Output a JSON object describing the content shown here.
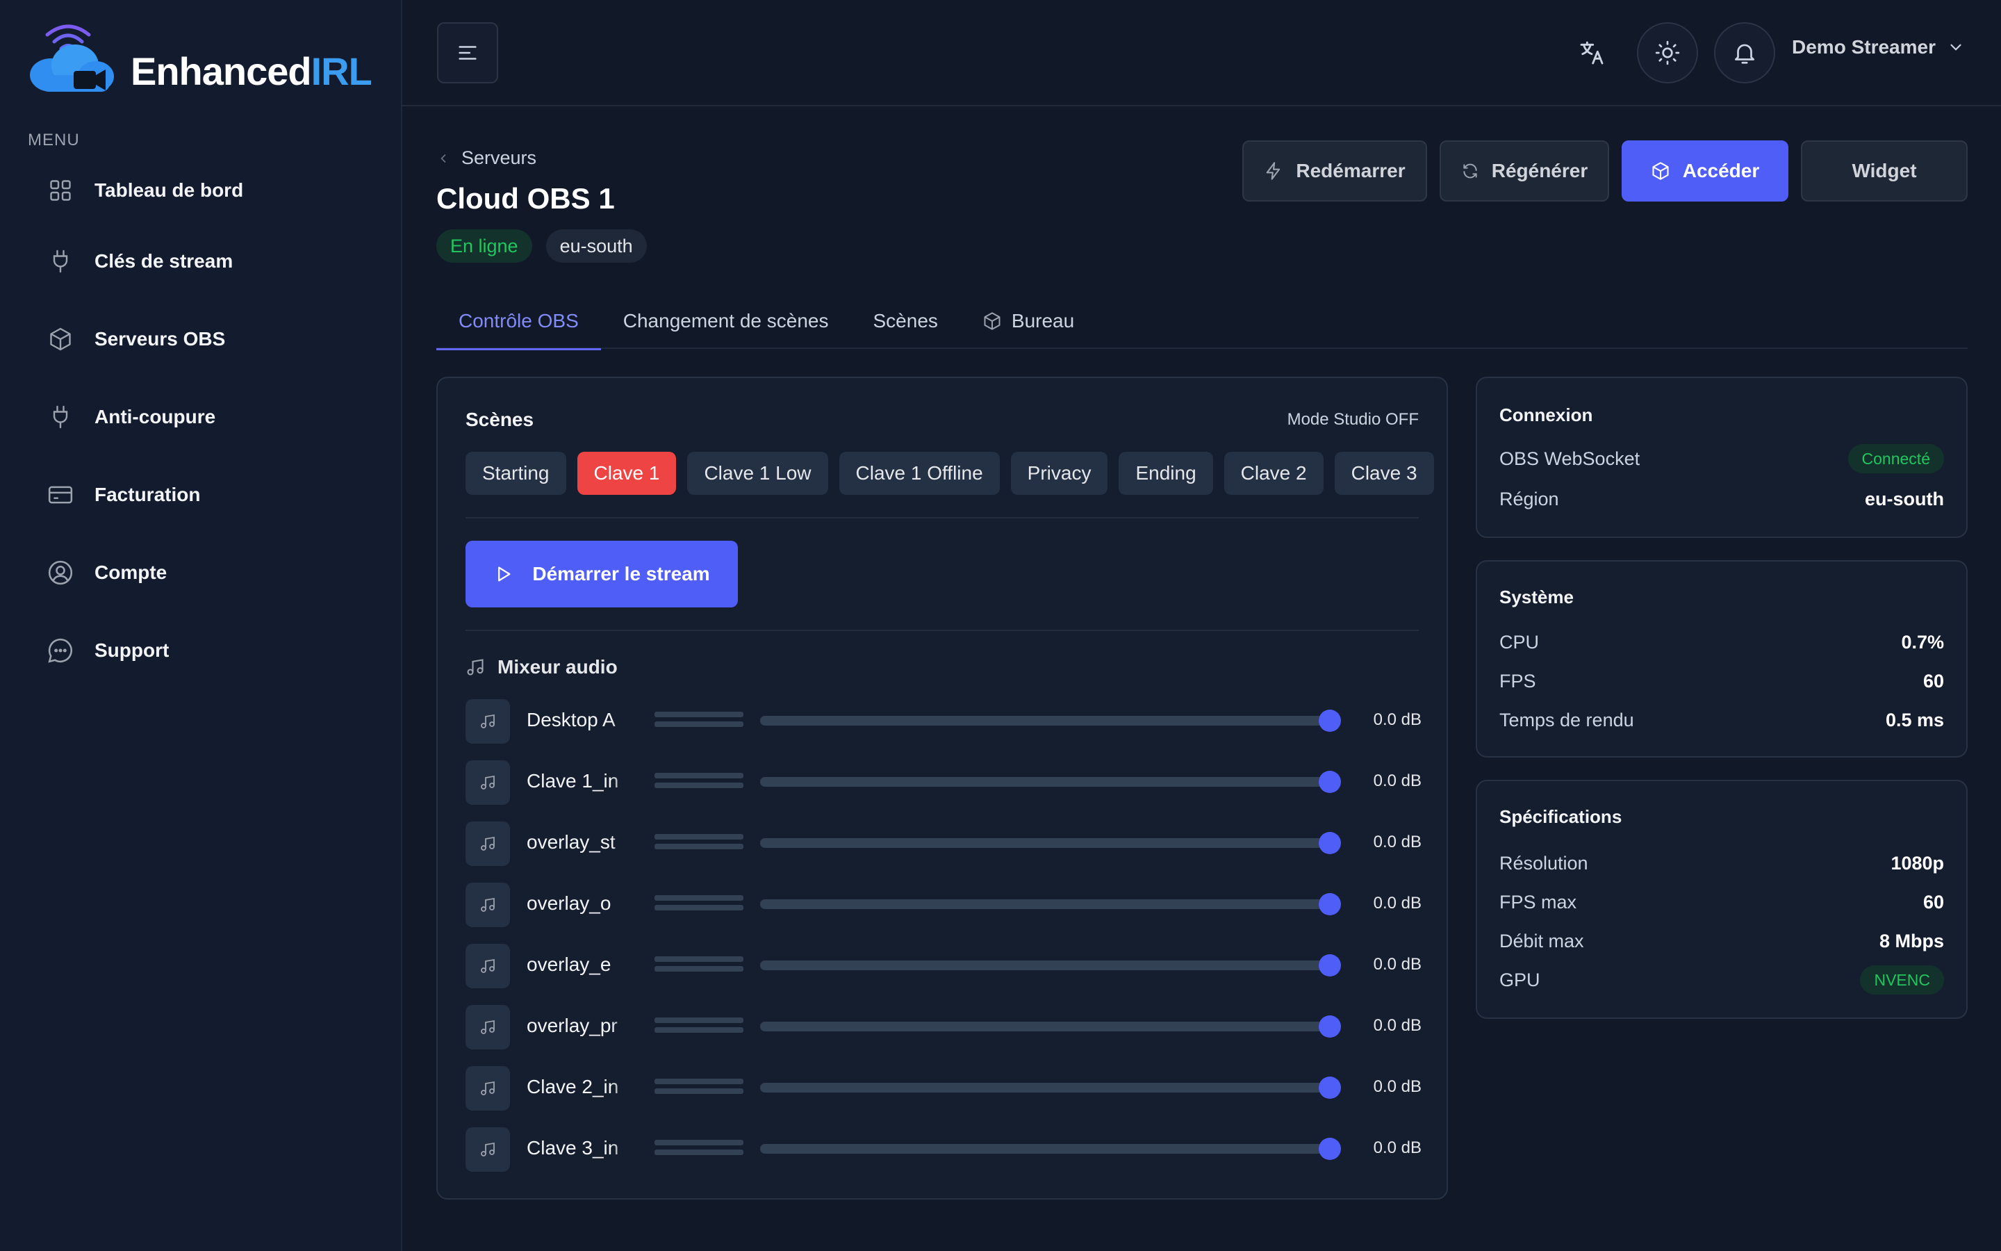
{
  "brand": {
    "name_part1": "Enhanced",
    "name_part2": "IRL"
  },
  "sidebar": {
    "menu_heading": "MENU",
    "items": [
      {
        "label": "Tableau de bord",
        "icon": "grid-icon"
      },
      {
        "label": "Clés de stream",
        "icon": "plug-icon"
      },
      {
        "label": "Serveurs OBS",
        "icon": "cube-icon"
      },
      {
        "label": "Anti-coupure",
        "icon": "plug-icon"
      },
      {
        "label": "Facturation",
        "icon": "credit-card-icon"
      },
      {
        "label": "Compte",
        "icon": "user-circle-icon"
      },
      {
        "label": "Support",
        "icon": "chat-icon"
      }
    ]
  },
  "header": {
    "user_name": "Demo Streamer"
  },
  "page": {
    "breadcrumb": "Serveurs",
    "title": "Cloud OBS 1",
    "status_badge": "En ligne",
    "region_badge": "eu-south",
    "actions": {
      "restart": "Redémarrer",
      "regenerate": "Régénérer",
      "access": "Accéder",
      "widget": "Widget"
    },
    "tabs": [
      "Contrôle OBS",
      "Changement de scènes",
      "Scènes",
      "Bureau"
    ]
  },
  "scenes": {
    "title": "Scènes",
    "studio_mode": "Mode Studio OFF",
    "items": [
      "Starting",
      "Clave 1",
      "Clave 1 Low",
      "Clave 1 Offline",
      "Privacy",
      "Ending",
      "Clave 2",
      "Clave 3"
    ],
    "active": "Clave 1",
    "start_stream": "Démarrer le stream"
  },
  "mixer": {
    "title": "Mixeur audio",
    "channels": [
      {
        "name": "Desktop A",
        "db": "0.0 dB",
        "level": 1.0
      },
      {
        "name": "Clave 1_in",
        "db": "0.0 dB",
        "level": 1.0
      },
      {
        "name": "overlay_st",
        "db": "0.0 dB",
        "level": 1.0
      },
      {
        "name": "overlay_o",
        "db": "0.0 dB",
        "level": 1.0
      },
      {
        "name": "overlay_e",
        "db": "0.0 dB",
        "level": 1.0
      },
      {
        "name": "overlay_pr",
        "db": "0.0 dB",
        "level": 1.0
      },
      {
        "name": "Clave 2_in",
        "db": "0.0 dB",
        "level": 1.0
      },
      {
        "name": "Clave 3_in",
        "db": "0.0 dB",
        "level": 1.0
      }
    ]
  },
  "connexion": {
    "title": "Connexion",
    "websocket_label": "OBS WebSocket",
    "websocket_status": "Connecté",
    "region_label": "Région",
    "region_value": "eu-south"
  },
  "systeme": {
    "title": "Système",
    "cpu_label": "CPU",
    "cpu_value": "0.7%",
    "fps_label": "FPS",
    "fps_value": "60",
    "render_label": "Temps de rendu",
    "render_value": "0.5 ms"
  },
  "specs": {
    "title": "Spécifications",
    "resolution_label": "Résolution",
    "resolution_value": "1080p",
    "fpsmax_label": "FPS max",
    "fpsmax_value": "60",
    "bitrate_label": "Débit max",
    "bitrate_value": "8 Mbps",
    "gpu_label": "GPU",
    "gpu_value": "NVENC"
  },
  "colors": {
    "accent": "#4f5ef7",
    "active_scene": "#ef4444",
    "success": "#22c55e",
    "brand_blue": "#3b9cf0"
  }
}
